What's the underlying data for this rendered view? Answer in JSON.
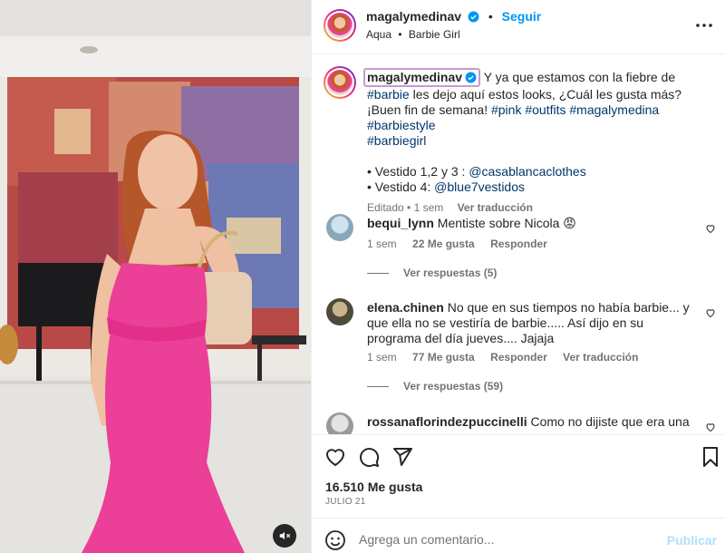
{
  "post_header": {
    "username": "magalymedinav",
    "follow_label": "Seguir",
    "separator": "•",
    "audio_artist": "Aqua",
    "audio_sep": "•",
    "audio_song": "Barbie Girl"
  },
  "caption": {
    "username": "magalymedinav",
    "text_1": " Y ya que estamos con la fiebre de ",
    "tag_barbie": "#barbie",
    "text_2": " les dejo aquí estos looks, ¿Cuál les gusta más? ¡Buen fin de semana! ",
    "tag_pink": "#pink",
    "tag_outfits": "#outfits",
    "tag_magalymedina": "#magalymedina",
    "tag_barbiestyle": "#barbiestyle",
    "tag_barbiegirl": "#barbiegirl",
    "line_1_prefix": "• Vestido 1,2 y 3 : ",
    "line_1_mention": "@casablancaclothes",
    "line_2_prefix": "• Vestido 4: ",
    "line_2_mention": "@blue7vestidos",
    "meta_time": "Editado • 1 sem",
    "translate_label": "Ver traducción"
  },
  "comments": [
    {
      "username": "bequi_lynn",
      "text": "Mentiste sobre Nicola 😡",
      "time": "1 sem",
      "likes": "22 Me gusta",
      "reply_label": "Responder",
      "replies_label": "Ver respuestas (5)"
    },
    {
      "username": "elena.chinen",
      "text": "No que en sus tiempos no había barbie... y que ella no se vestiría de barbie..... Así dijo en su programa del día jueves.... Jajaja",
      "time": "1 sem",
      "likes": "77 Me gusta",
      "reply_label": "Responder",
      "translate_label": "Ver traducción",
      "replies_label": "Ver respuestas (59)"
    },
    {
      "username": "rossanaflorindezpuccinelli",
      "text": "Como no dijiste que era una"
    }
  ],
  "actions": {
    "likes_count": "16.510 Me gusta",
    "date": "JULIO 21"
  },
  "composer": {
    "placeholder": "Agrega un comentario...",
    "post_label": "Publicar"
  },
  "icons": {
    "verified": "verified-badge-icon",
    "more": "more-options-icon",
    "like": "heart-icon",
    "comment": "comment-icon",
    "share": "share-icon",
    "save": "bookmark-icon",
    "emoji": "emoji-icon",
    "mute": "audio-muted-icon"
  },
  "colors": {
    "link_blue": "#0095f6",
    "hashtag": "#00376b",
    "dress_pink": "#ec3f97",
    "muted_text": "#737373"
  }
}
